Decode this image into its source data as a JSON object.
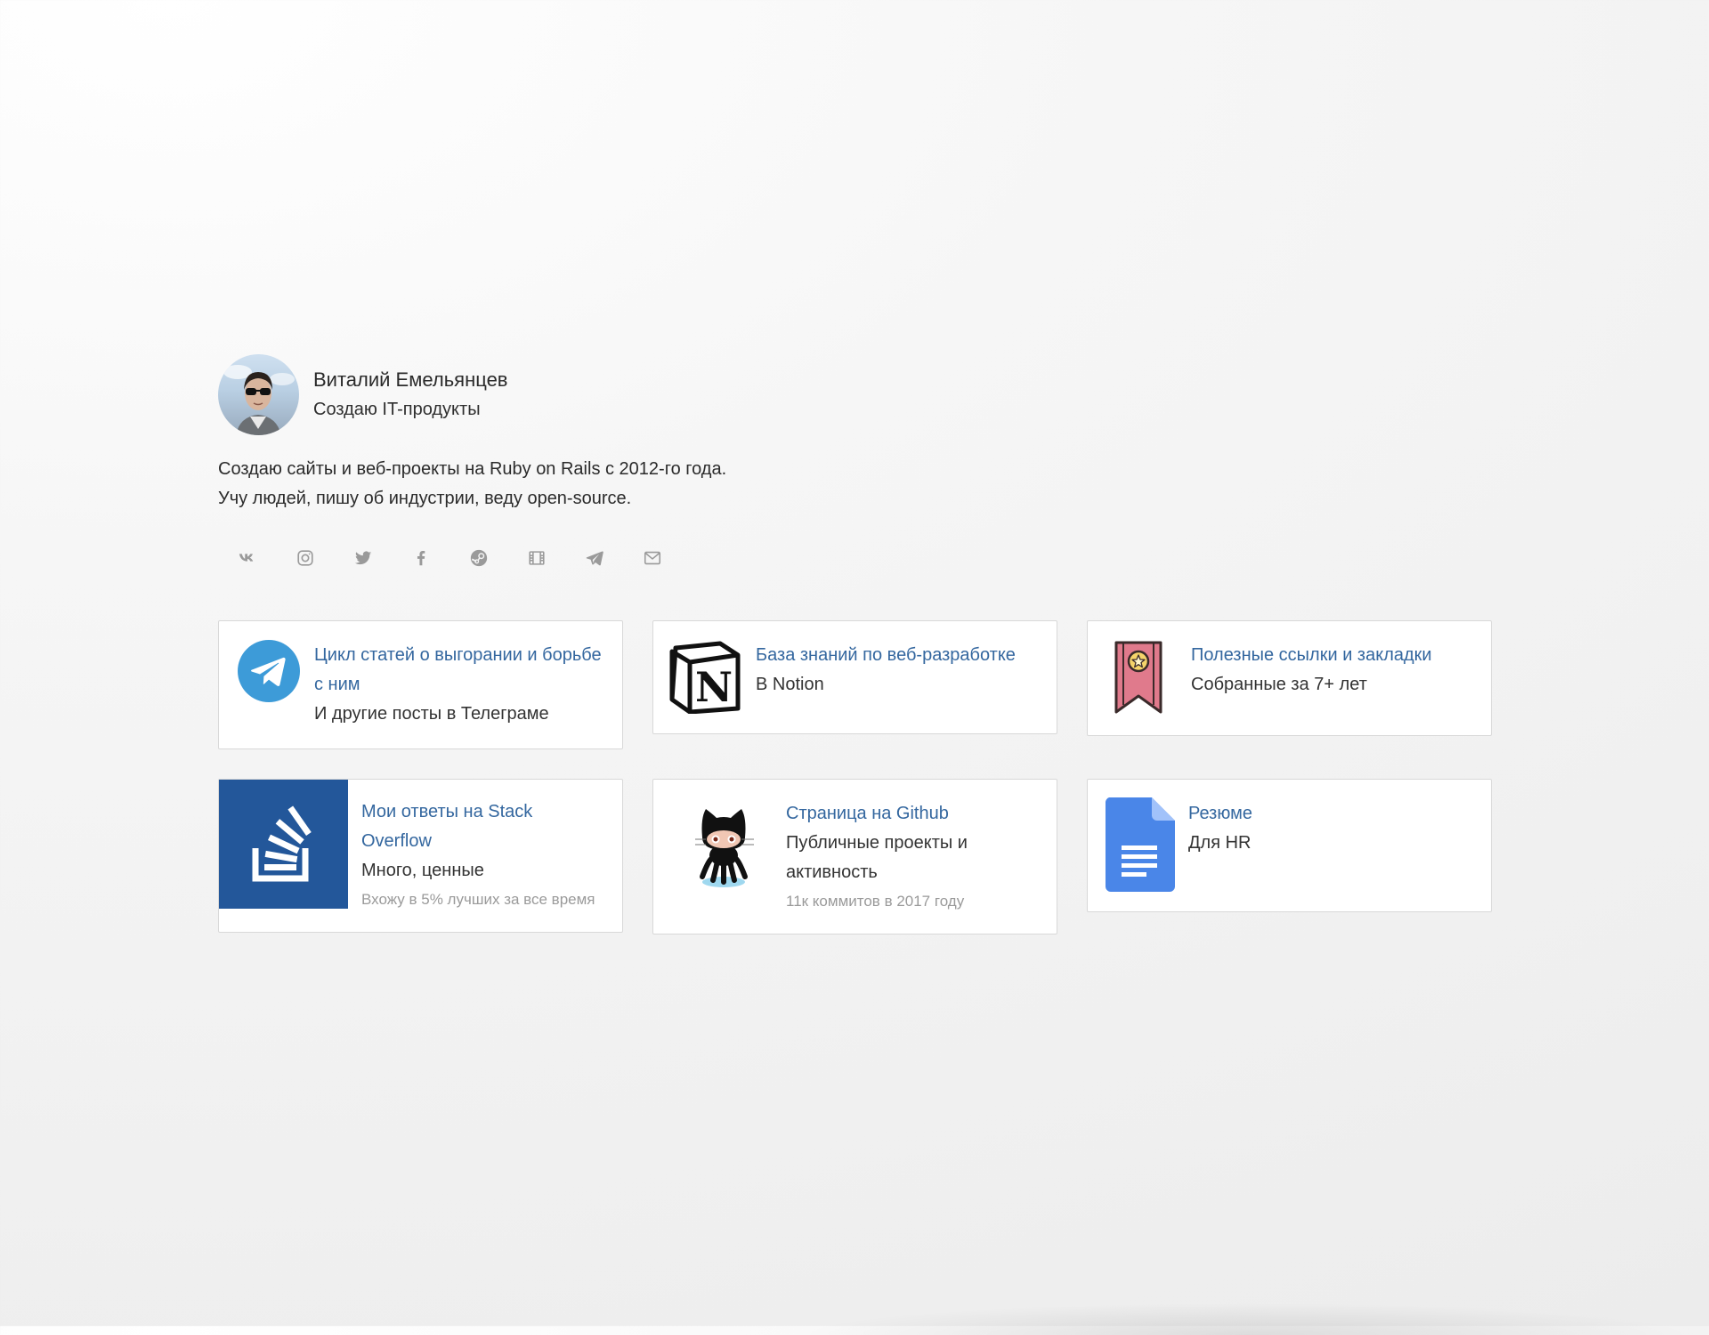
{
  "profile": {
    "name": "Виталий Емельянцев",
    "tagline": "Создаю IT-продукты",
    "bio_line_1": "Создаю сайты и веб-проекты на Ruby on Rails с 2012-го года.",
    "bio_line_2": "Учу людей, пишу об индустрии, веду open-source."
  },
  "socials": [
    {
      "icon": "vk-icon"
    },
    {
      "icon": "instagram-icon"
    },
    {
      "icon": "twitter-icon"
    },
    {
      "icon": "facebook-icon"
    },
    {
      "icon": "steam-icon"
    },
    {
      "icon": "film-icon"
    },
    {
      "icon": "telegram-icon"
    },
    {
      "icon": "mail-icon"
    }
  ],
  "cards": [
    {
      "icon": "telegram-logo-icon",
      "title": "Цикл статей о выгорании и борьбе с ним",
      "subtitle": "И другие посты в Телеграме"
    },
    {
      "icon": "notion-logo-icon",
      "title": "База знаний по веб-разработке",
      "subtitle": "В Notion"
    },
    {
      "icon": "bookmark-ribbon-icon",
      "title": "Полезные ссылки и закладки",
      "subtitle": "Собранные за 7+ лет"
    },
    {
      "icon": "stackoverflow-logo-icon",
      "title": "Мои ответы на Stack Overflow",
      "subtitle": "Много, ценные",
      "note": "Вхожу в 5% лучших за все время"
    },
    {
      "icon": "github-octocat-icon",
      "title": "Страница на Github",
      "subtitle": "Публичные проекты и активность",
      "note": "11к коммитов в 2017 году"
    },
    {
      "icon": "google-docs-icon",
      "title": "Резюме",
      "subtitle": "Для HR"
    }
  ],
  "colors": {
    "link": "#34679f",
    "telegram": "#3d9bd8",
    "stackoverflow_bg": "#23579a",
    "ribbon": "#e07a8c",
    "docs": "#4a86e8"
  }
}
